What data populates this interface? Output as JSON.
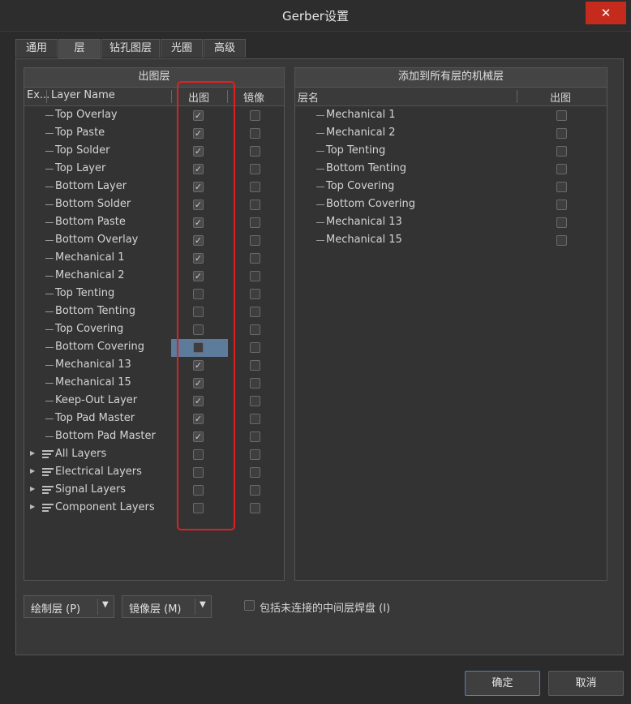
{
  "window": {
    "title": "Gerber设置",
    "close_glyph": "✕"
  },
  "tabs": [
    {
      "label": "通用"
    },
    {
      "label": "层"
    },
    {
      "label": "钻孔图层"
    },
    {
      "label": "光圈"
    },
    {
      "label": "高级"
    }
  ],
  "active_tab": "层",
  "left_panel": {
    "header": "出图层",
    "col_ex": "Ex...",
    "col_name": "Layer Name",
    "col_plot": "出图",
    "col_mirror": "镜像",
    "layers": [
      {
        "name": "Top Overlay",
        "plot": true,
        "mirror": false
      },
      {
        "name": "Top Paste",
        "plot": true,
        "mirror": false
      },
      {
        "name": "Top Solder",
        "plot": true,
        "mirror": false
      },
      {
        "name": "Top Layer",
        "plot": true,
        "mirror": false
      },
      {
        "name": "Bottom Layer",
        "plot": true,
        "mirror": false
      },
      {
        "name": "Bottom Solder",
        "plot": true,
        "mirror": false
      },
      {
        "name": "Bottom Paste",
        "plot": true,
        "mirror": false
      },
      {
        "name": "Bottom Overlay",
        "plot": true,
        "mirror": false
      },
      {
        "name": "Mechanical 1",
        "plot": true,
        "mirror": false
      },
      {
        "name": "Mechanical 2",
        "plot": true,
        "mirror": false
      },
      {
        "name": "Top Tenting",
        "plot": false,
        "mirror": false
      },
      {
        "name": "Bottom Tenting",
        "plot": false,
        "mirror": false
      },
      {
        "name": "Top Covering",
        "plot": false,
        "mirror": false
      },
      {
        "name": "Bottom Covering",
        "plot": false,
        "mirror": false,
        "selected": true
      },
      {
        "name": "Mechanical 13",
        "plot": true,
        "mirror": false
      },
      {
        "name": "Mechanical 15",
        "plot": true,
        "mirror": false
      },
      {
        "name": "Keep-Out Layer",
        "plot": true,
        "mirror": false
      },
      {
        "name": "Top Pad Master",
        "plot": true,
        "mirror": false
      },
      {
        "name": "Bottom Pad Master",
        "plot": true,
        "mirror": false
      }
    ],
    "groups": [
      {
        "name": "All Layers",
        "plot": false,
        "mirror": false
      },
      {
        "name": "Electrical Layers",
        "plot": false,
        "mirror": false
      },
      {
        "name": "Signal Layers",
        "plot": false,
        "mirror": false
      },
      {
        "name": "Component Layers",
        "plot": false,
        "mirror": false
      }
    ]
  },
  "right_panel": {
    "header": "添加到所有层的机械层",
    "col_name": "层名",
    "col_plot": "出图",
    "layers": [
      {
        "name": "Mechanical 1",
        "plot": false
      },
      {
        "name": "Mechanical 2",
        "plot": false
      },
      {
        "name": "Top Tenting",
        "plot": false
      },
      {
        "name": "Bottom Tenting",
        "plot": false
      },
      {
        "name": "Top Covering",
        "plot": false
      },
      {
        "name": "Bottom Covering",
        "plot": false
      },
      {
        "name": "Mechanical 13",
        "plot": false
      },
      {
        "name": "Mechanical 15",
        "plot": false
      }
    ]
  },
  "bottom": {
    "plot_layers_btn": "绘制层 (P)",
    "mirror_layers_btn": "镜像层 (M)",
    "include_unconnected_label": "包括未连接的中间层焊盘 (I)",
    "include_unconnected_checked": false
  },
  "dialog": {
    "ok": "确定",
    "cancel": "取消"
  },
  "colors": {
    "highlight_frame": "#e02020",
    "selection": "#5d7b9b",
    "primary_border": "#4f83b8"
  },
  "icons": {
    "check": "✓",
    "expand": "▶",
    "dropdown": "▼"
  }
}
